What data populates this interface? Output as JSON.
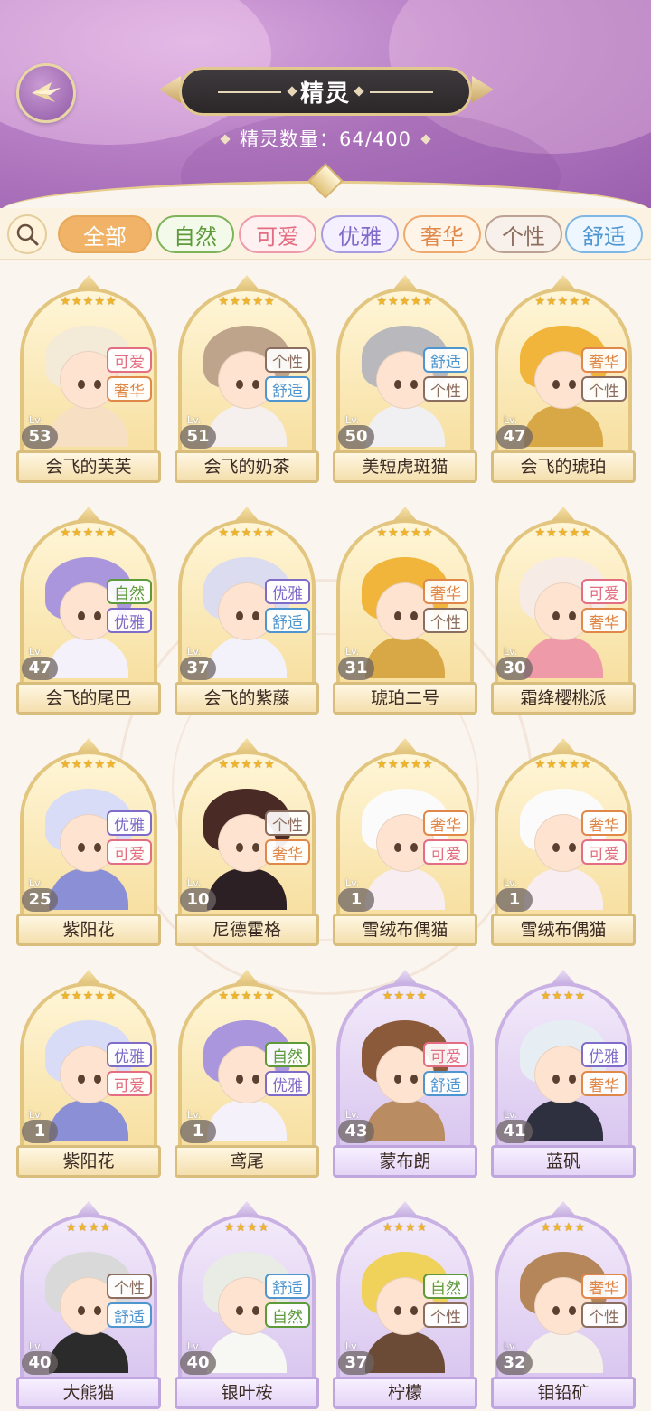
{
  "header": {
    "title": "精灵",
    "count_label": "精灵数量：64/400"
  },
  "filters": [
    {
      "label": "全部",
      "active": true,
      "color": "#e8a85a",
      "text": "#ffffff",
      "bg": "#f0b367"
    },
    {
      "label": "自然",
      "active": false,
      "color": "#7fb35a",
      "text": "#5c9a3a",
      "bg": "#f3fae9"
    },
    {
      "label": "可爱",
      "active": false,
      "color": "#ef9aa8",
      "text": "#e36d83",
      "bg": "#fff1f2"
    },
    {
      "label": "优雅",
      "active": false,
      "color": "#a99be0",
      "text": "#7f6cc9",
      "bg": "#f4f0ff"
    },
    {
      "label": "奢华",
      "active": false,
      "color": "#efa96e",
      "text": "#e0884a",
      "bg": "#fff4e8"
    },
    {
      "label": "个性",
      "active": false,
      "color": "#bba295",
      "text": "#8c6e60",
      "bg": "#f8f0ea"
    },
    {
      "label": "舒适",
      "active": false,
      "color": "#7fb7e4",
      "text": "#4f95cf",
      "bg": "#eef7ff"
    }
  ],
  "tag_colors": {
    "可爱": "#e36d83",
    "奢华": "#e0884a",
    "个性": "#8c6e60",
    "舒适": "#4f95cf",
    "自然": "#5c9a3a",
    "优雅": "#7f6cc9"
  },
  "level_prefix": "Lv.",
  "cards": [
    {
      "name": "会飞的芙芙",
      "level": "53",
      "stars": 5,
      "tags": [
        "可爱",
        "奢华"
      ],
      "frame": "gold",
      "hair": "#f3ead8",
      "body": "#f6dfc2"
    },
    {
      "name": "会飞的奶茶",
      "level": "51",
      "stars": 5,
      "tags": [
        "个性",
        "舒适"
      ],
      "frame": "gold",
      "hair": "#bfa48c",
      "body": "#f5f0ee"
    },
    {
      "name": "美短虎斑猫",
      "level": "50",
      "stars": 5,
      "tags": [
        "舒适",
        "个性"
      ],
      "frame": "gold",
      "hair": "#b9b9bd",
      "body": "#f0f0f2"
    },
    {
      "name": "会飞的琥珀",
      "level": "47",
      "stars": 5,
      "tags": [
        "奢华",
        "个性"
      ],
      "frame": "gold",
      "hair": "#f0b53a",
      "body": "#d7a845"
    },
    {
      "name": "会飞的尾巴",
      "level": "47",
      "stars": 5,
      "tags": [
        "自然",
        "优雅"
      ],
      "frame": "gold",
      "hair": "#a996dc",
      "body": "#f5f1fa"
    },
    {
      "name": "会飞的紫藤",
      "level": "37",
      "stars": 5,
      "tags": [
        "优雅",
        "舒适"
      ],
      "frame": "gold",
      "hair": "#dcdcf0",
      "body": "#f3f2fb"
    },
    {
      "name": "琥珀二号",
      "level": "31",
      "stars": 5,
      "tags": [
        "奢华",
        "个性"
      ],
      "frame": "gold",
      "hair": "#f0b53a",
      "body": "#d7a845"
    },
    {
      "name": "霜绛樱桃派",
      "level": "30",
      "stars": 5,
      "tags": [
        "可爱",
        "奢华"
      ],
      "frame": "gold",
      "hair": "#f7ebe6",
      "body": "#ef9aa8"
    },
    {
      "name": "紫阳花",
      "level": "25",
      "stars": 5,
      "tags": [
        "优雅",
        "可爱"
      ],
      "frame": "gold",
      "hair": "#d8dcf6",
      "body": "#8b8fd6"
    },
    {
      "name": "尼德霍格",
      "level": "10",
      "stars": 5,
      "tags": [
        "个性",
        "奢华"
      ],
      "frame": "gold",
      "hair": "#4a2a24",
      "body": "#2d2024"
    },
    {
      "name": "雪绒布偶猫",
      "level": "1",
      "stars": 5,
      "tags": [
        "奢华",
        "可爱"
      ],
      "frame": "gold",
      "hair": "#fbfbfb",
      "body": "#f8eef2"
    },
    {
      "name": "雪绒布偶猫",
      "level": "1",
      "stars": 5,
      "tags": [
        "奢华",
        "可爱"
      ],
      "frame": "gold",
      "hair": "#fbfbfb",
      "body": "#f8eef2"
    },
    {
      "name": "紫阳花",
      "level": "1",
      "stars": 5,
      "tags": [
        "优雅",
        "可爱"
      ],
      "frame": "gold",
      "hair": "#d8dcf6",
      "body": "#8b8fd6"
    },
    {
      "name": "鸢尾",
      "level": "1",
      "stars": 5,
      "tags": [
        "自然",
        "优雅"
      ],
      "frame": "gold",
      "hair": "#a996dc",
      "body": "#f5f1fa"
    },
    {
      "name": "蒙布朗",
      "level": "43",
      "stars": 4,
      "tags": [
        "可爱",
        "舒适"
      ],
      "frame": "purple",
      "hair": "#8a5a3a",
      "body": "#b98c62"
    },
    {
      "name": "蓝矾",
      "level": "41",
      "stars": 4,
      "tags": [
        "优雅",
        "奢华"
      ],
      "frame": "purple",
      "hair": "#e7eef3",
      "body": "#2e3040"
    },
    {
      "name": "大熊猫",
      "level": "40",
      "stars": 4,
      "tags": [
        "个性",
        "舒适"
      ],
      "frame": "purple",
      "hair": "#d9d9d9",
      "body": "#2b2b2b"
    },
    {
      "name": "银叶桉",
      "level": "40",
      "stars": 4,
      "tags": [
        "舒适",
        "自然"
      ],
      "frame": "purple",
      "hair": "#e8ece4",
      "body": "#f7f7f3"
    },
    {
      "name": "柠檬",
      "level": "37",
      "stars": 4,
      "tags": [
        "自然",
        "个性"
      ],
      "frame": "purple",
      "hair": "#f0d25a",
      "body": "#6b4a36"
    },
    {
      "name": "钼铅矿",
      "level": "32",
      "stars": 4,
      "tags": [
        "奢华",
        "个性"
      ],
      "frame": "purple",
      "hair": "#b58659",
      "body": "#f5f1ea"
    }
  ]
}
